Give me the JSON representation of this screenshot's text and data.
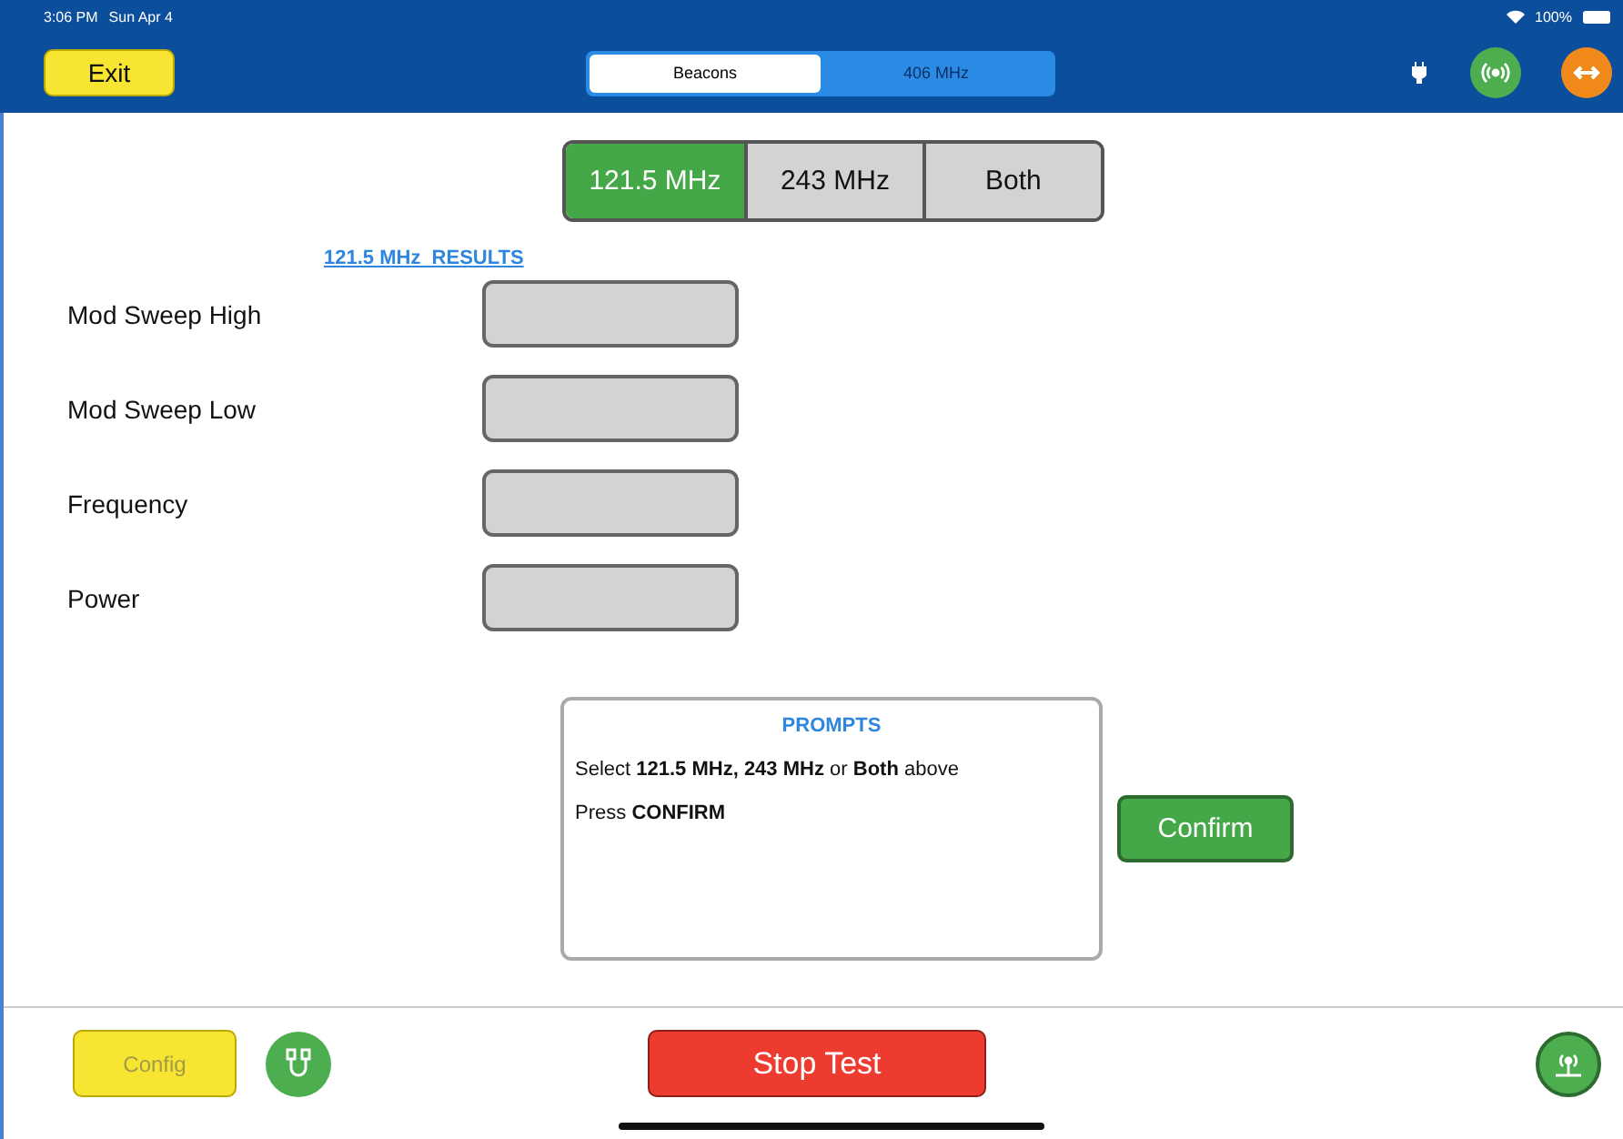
{
  "status_bar": {
    "time": "3:06 PM",
    "date": "Sun Apr 4",
    "battery": "100%"
  },
  "toolbar": {
    "exit": "Exit",
    "tabs": [
      {
        "label": "Beacons",
        "selected": true
      },
      {
        "label": "406 MHz",
        "selected": false
      }
    ]
  },
  "bands": [
    {
      "label": "121.5 MHz",
      "selected": true
    },
    {
      "label": "243 MHz",
      "selected": false
    },
    {
      "label": "Both",
      "selected": false
    }
  ],
  "results_link": "121.5 MHz  RESULTS",
  "fields": [
    {
      "label": "Mod Sweep High"
    },
    {
      "label": "Mod Sweep Low"
    },
    {
      "label": "Frequency"
    },
    {
      "label": "Power"
    }
  ],
  "prompts": {
    "title": "PROMPTS",
    "lines": [
      "Select **121.5 MHz, 243 MHz** or **Both** above",
      "Press **CONFIRM**"
    ]
  },
  "confirm": "Confirm",
  "footer": {
    "config": {
      "label": "Config",
      "disabled": true
    },
    "stop": "Stop Test"
  }
}
